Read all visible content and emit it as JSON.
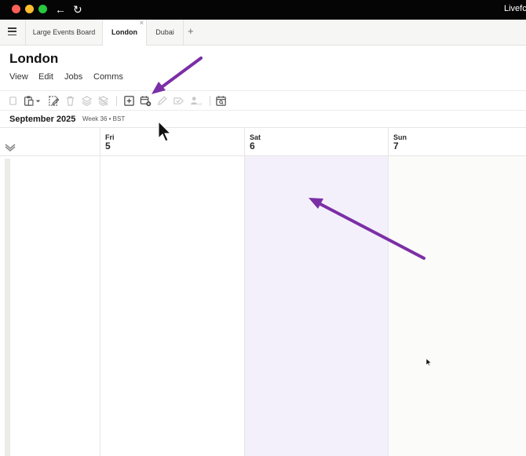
{
  "window": {
    "app_name": "Livefc",
    "back_icon": "arrow-left-icon",
    "reload_icon": "reload-icon"
  },
  "tabs": [
    {
      "label": "Large Events Board",
      "active": false
    },
    {
      "label": "London",
      "active": true
    },
    {
      "label": "Dubai",
      "active": false
    }
  ],
  "tab_add_label": "+",
  "page": {
    "title": "London",
    "menu": [
      "View",
      "Edit",
      "Jobs",
      "Comms"
    ]
  },
  "toolbar": {
    "icons": [
      "copy-icon",
      "paste-icon",
      "select-edit-icon",
      "delete-icon",
      "layers-icon",
      "layers-off-icon",
      "add-box-icon",
      "add-event-icon",
      "pencil-icon",
      "tag-check-icon",
      "assign-user-icon",
      "calendar-search-icon"
    ]
  },
  "calendar": {
    "month_label": "September 2025",
    "week_label": "Week 36 • BST",
    "days": [
      {
        "name": "Fri",
        "number": "5"
      },
      {
        "name": "Sat",
        "number": "6"
      },
      {
        "name": "Sun",
        "number": "7"
      }
    ]
  },
  "colors": {
    "annotation_arrow": "#7b2fa6",
    "highlight_column": "#f4f0fb",
    "title_bar": "#050505"
  }
}
